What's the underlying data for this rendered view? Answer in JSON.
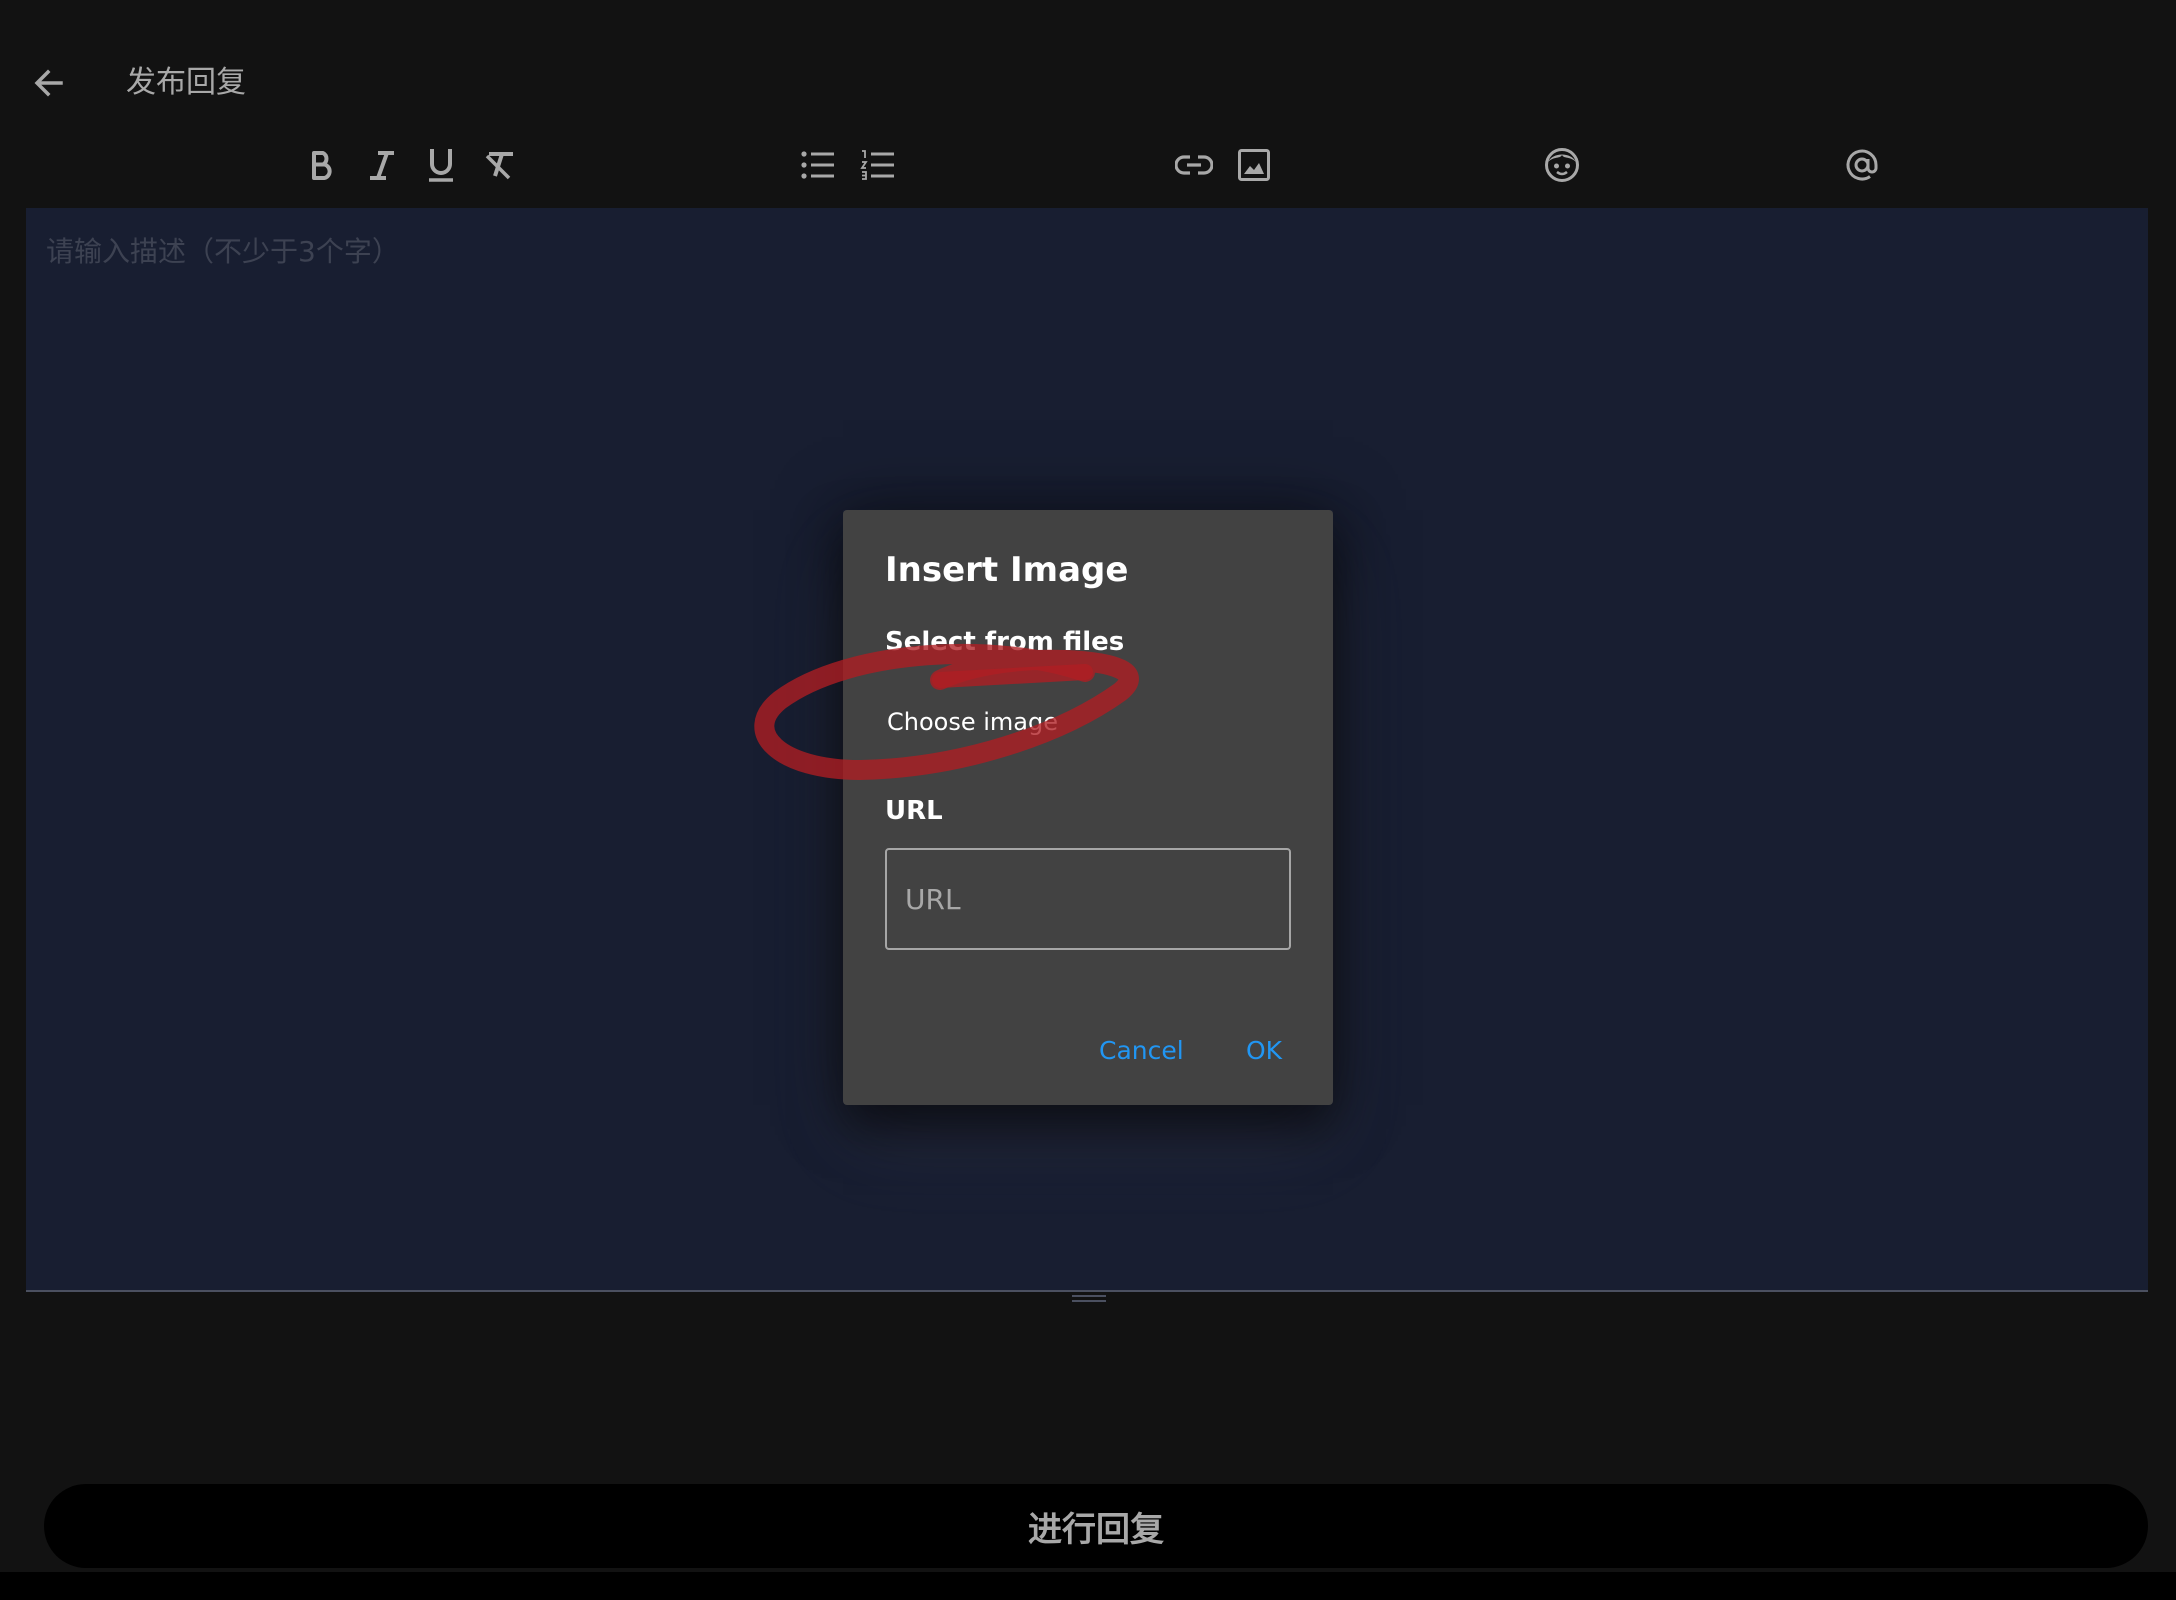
{
  "header": {
    "title": "发布回复"
  },
  "editor": {
    "placeholder": "请输入描述（不少于3个字）"
  },
  "dialog": {
    "title": "Insert Image",
    "select_label": "Select from files",
    "choose_button": "Choose image",
    "url_label": "URL",
    "url_placeholder": "URL",
    "url_value": "",
    "cancel_label": "Cancel",
    "ok_label": "OK"
  },
  "footer": {
    "submit_label": "进行回复"
  },
  "colors": {
    "background": "#121212",
    "editor_bg": "#181e31",
    "dialog_bg": "#424242",
    "accent": "#2196f3",
    "annotation": "#b01e23"
  },
  "toolbar_icons": [
    "bold-icon",
    "italic-icon",
    "underline-icon",
    "clear-format-icon",
    "bullet-list-icon",
    "numbered-list-icon",
    "link-icon",
    "image-icon",
    "emoji-icon",
    "at-mention-icon"
  ]
}
